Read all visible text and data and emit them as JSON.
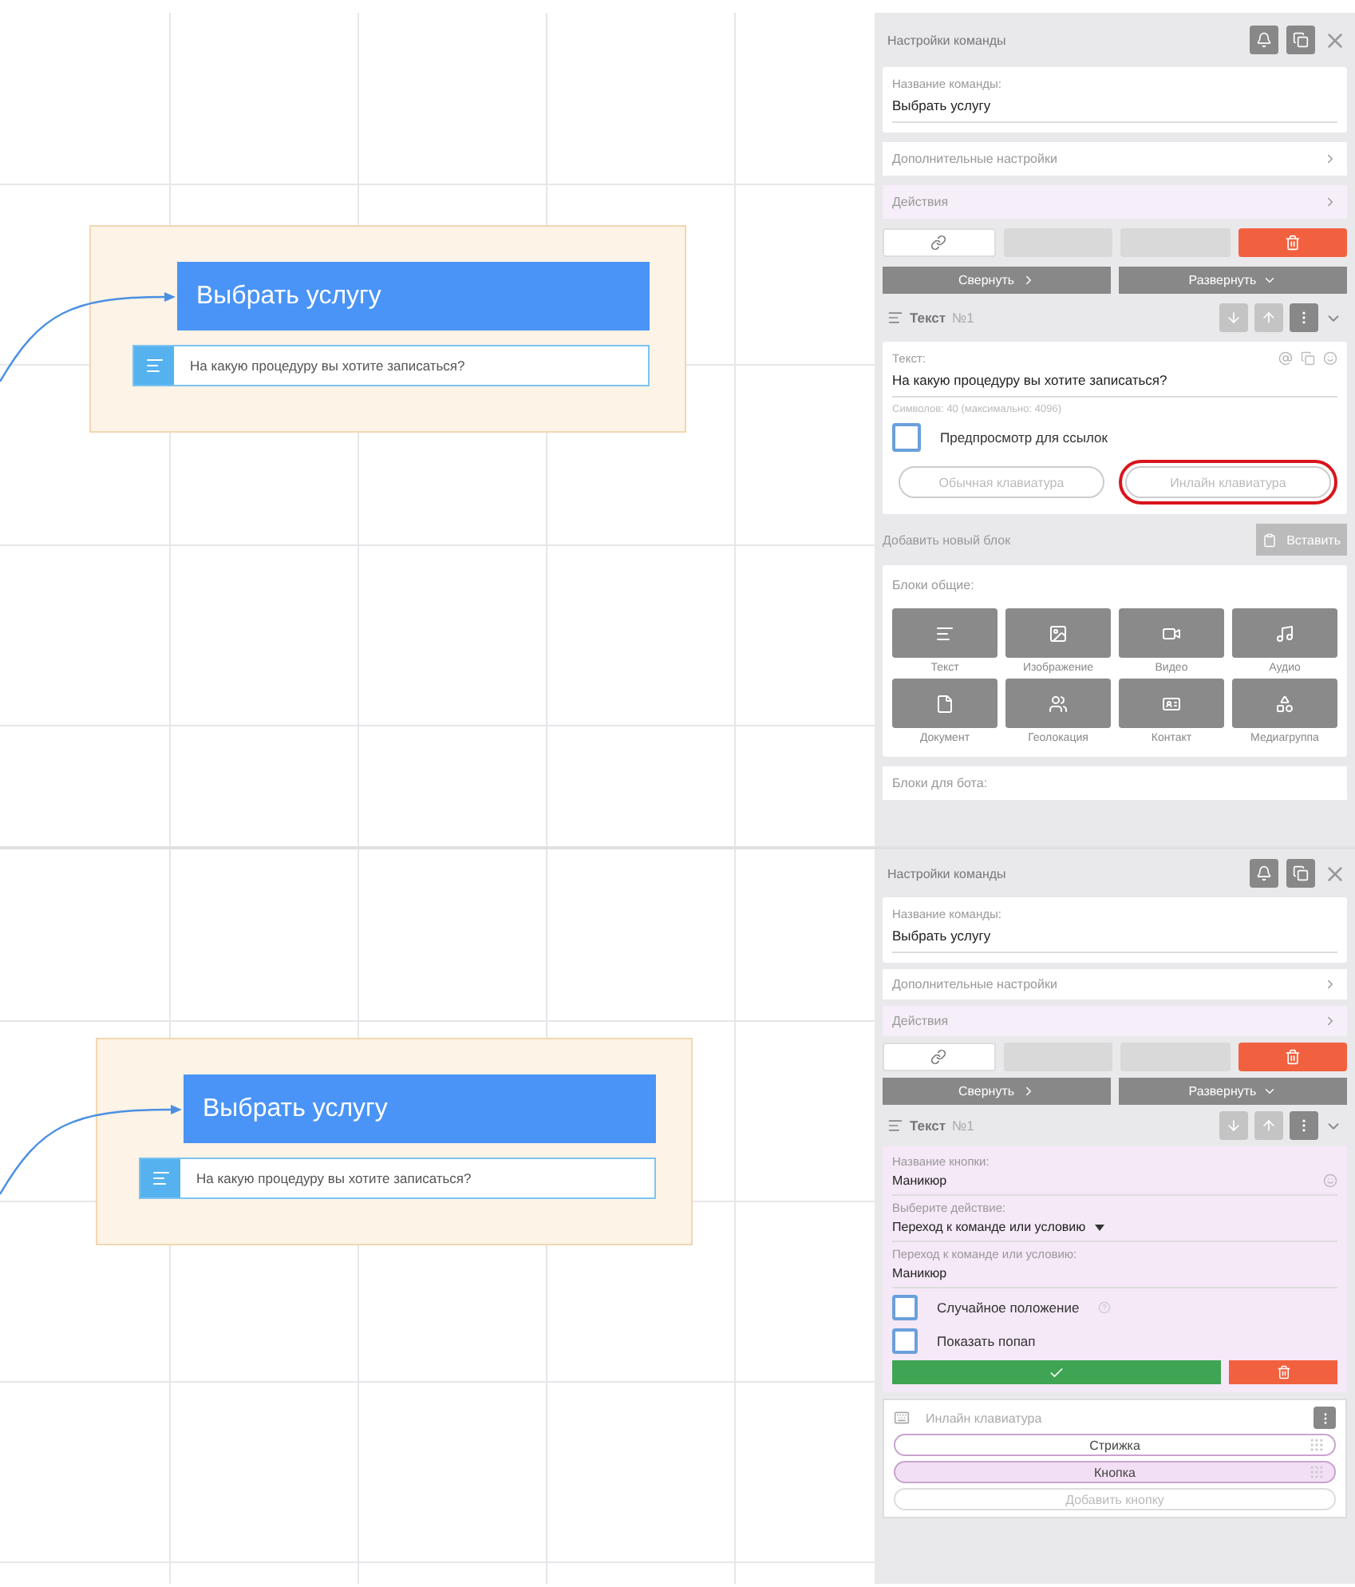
{
  "screens": [
    {
      "canvas": {
        "node_title": "Выбрать услугу",
        "node_text": "На какую процедуру вы хотите записаться?"
      },
      "panel": {
        "title": "Настройки команды",
        "name_label": "Название команды:",
        "name_value": "Выбрать услугу",
        "rows": [
          {
            "label": "Дополнительные настройки",
            "tinted": false
          },
          {
            "label": "Действия",
            "tinted": true
          }
        ],
        "collapse": "Свернуть",
        "expand": "Развернуть",
        "block_title": "Текст",
        "block_number": "№1",
        "sections": [
          {
            "kind": "text_card",
            "label": "Текст:",
            "value": "На какую процедуру вы хотите записаться?",
            "counter": "Символов: 40 (максимально: 4096)",
            "checkbox": {
              "label": "Предпросмотр для ссылок",
              "checked": false
            },
            "keyboards": [
              {
                "label": "Обычная клавиатура",
                "annotated": false
              },
              {
                "label": "Инлайн клавиатура",
                "annotated": true
              }
            ]
          },
          {
            "kind": "add_block",
            "label": "Добавить новый блок",
            "paste": "Вставить"
          },
          {
            "kind": "blocks_grid",
            "title": "Блоки общие:",
            "items": [
              {
                "kind": "text",
                "label": "Текст"
              },
              {
                "kind": "image",
                "label": "Изображение"
              },
              {
                "kind": "video",
                "label": "Видео"
              },
              {
                "kind": "audio",
                "label": "Аудио"
              },
              {
                "kind": "document",
                "label": "Документ"
              },
              {
                "kind": "geo",
                "label": "Геолокация"
              },
              {
                "kind": "contact",
                "label": "Контакт"
              },
              {
                "kind": "media",
                "label": "Медиагруппа"
              }
            ],
            "footer": "Блоки для бота:"
          }
        ]
      }
    },
    {
      "canvas": {
        "node_title": "Выбрать услугу",
        "node_text": "На какую процедуру вы хотите записаться?"
      },
      "panel": {
        "title": "Настройки команды",
        "name_label": "Название команды:",
        "name_value": "Выбрать услугу",
        "rows": [
          {
            "label": "Дополнительные настройки",
            "tinted": false
          },
          {
            "label": "Действия",
            "tinted": true
          }
        ],
        "collapse": "Свернуть",
        "expand": "Развернуть",
        "block_title": "Текст",
        "block_number": "№1",
        "sections": [
          {
            "kind": "button_form",
            "fields": [
              {
                "kind": "input",
                "label": "Название кнопки:",
                "value": "Маникюр",
                "emoji": true
              },
              {
                "kind": "select",
                "label": "Выберите действие:",
                "value": "Переход к команде или условию",
                "emoji": false
              },
              {
                "kind": "input",
                "label": "Переход к команде или условию:",
                "value": "Маникюр",
                "emoji": false
              }
            ],
            "checkboxes": [
              {
                "label": "Случайное положение",
                "checked": false,
                "help": true
              },
              {
                "label": "Показать попап",
                "checked": false,
                "help": false
              }
            ]
          },
          {
            "kind": "inline_keyboard",
            "title": "Инлайн клавиатура",
            "buttons": [
              {
                "label": "Стрижка",
                "selected": false
              },
              {
                "label": "Кнопка",
                "selected": true
              }
            ],
            "add": "Добавить кнопку"
          }
        ]
      }
    }
  ]
}
